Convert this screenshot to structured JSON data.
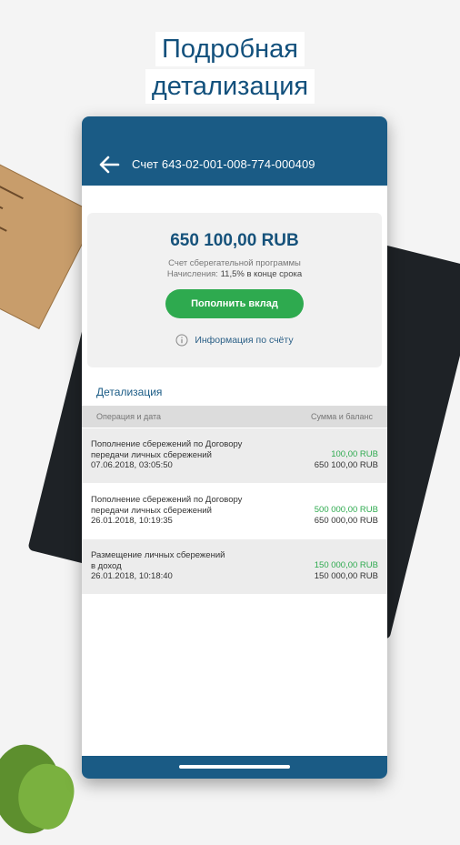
{
  "promo": {
    "line1": "Подробная",
    "line2": "детализация"
  },
  "header": {
    "account_title": "Счет 643-02-001-008-774-000409"
  },
  "summary": {
    "amount": "650 100,00 RUB",
    "program": "Счет сберегательной программы",
    "accrual_label": "Начисления:",
    "accrual_value": "11,5% в конце срока",
    "topup_button": "Пополнить вклад",
    "info_link": "Информация по счёту"
  },
  "details": {
    "section_title": "Детализация",
    "col_left": "Операция и дата",
    "col_right": "Сумма и баланс",
    "rows": [
      {
        "line1": "Пополнение сбережений по Договору",
        "line2": "передачи личных сбережений",
        "date": "07.06.2018, 03:05:50",
        "amount": "100,00 RUB",
        "balance": "650 100,00 RUB"
      },
      {
        "line1": "Пополнение сбережений по Договору",
        "line2": "передачи личных сбережений",
        "date": "26.01.2018, 10:19:35",
        "amount": "500 000,00 RUB",
        "balance": "650 000,00 RUB"
      },
      {
        "line1": "Размещение личных сбережений",
        "line2": "в доход",
        "date": "26.01.2018, 10:18:40",
        "amount": "150 000,00 RUB",
        "balance": "150 000,00 RUB"
      }
    ]
  },
  "colors": {
    "brand": "#1a5b85",
    "accent_green": "#2eaa4f"
  },
  "icons": {
    "back": "arrow-left-icon",
    "info": "info-circle-icon"
  }
}
